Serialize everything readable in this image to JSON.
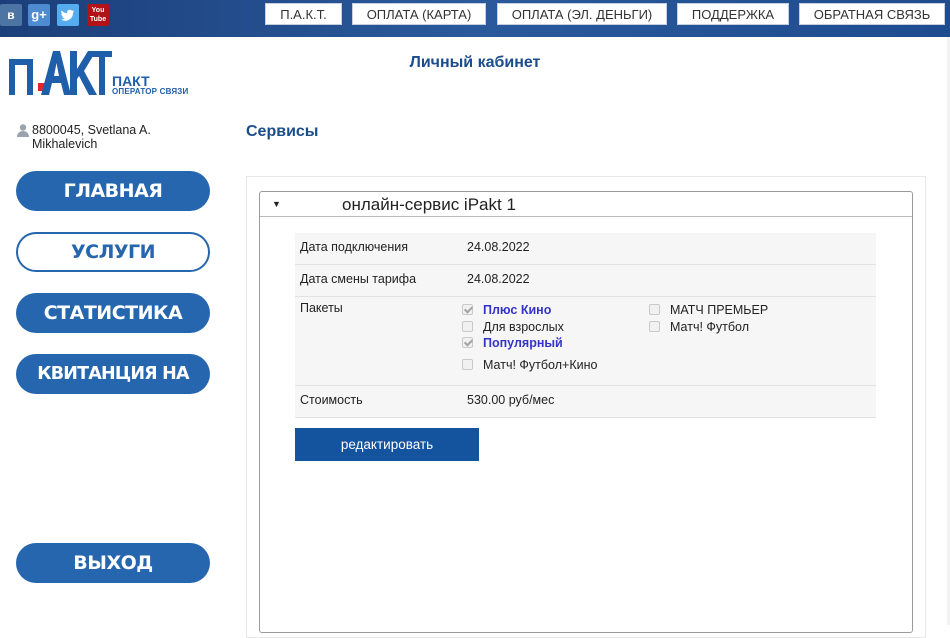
{
  "social": {
    "vk": "в",
    "gplus": "g+",
    "twitter": "🐦",
    "youtube_top": "You",
    "youtube_bottom": "Tube"
  },
  "topnav": [
    {
      "label": "П.А.К.Т."
    },
    {
      "label": "ОПЛАТА (КАРТА)"
    },
    {
      "label": "ОПЛАТА (ЭЛ. ДЕНЬГИ)"
    },
    {
      "label": "ПОДДЕРЖКА"
    },
    {
      "label": "ОБРАТНАЯ СВЯЗЬ"
    }
  ],
  "logo": {
    "name": "ПАКТ",
    "subtitle": "ОПЕРАТОР СВЯЗИ"
  },
  "page_title": "Личный кабинет",
  "user": {
    "line1": "8800045, Svetlana A.",
    "line2": "Mikhalevich"
  },
  "menu": [
    {
      "label": "ГЛАВНАЯ",
      "active": false
    },
    {
      "label": "УСЛУГИ",
      "active": true
    },
    {
      "label": "СТАТИСТИКА",
      "active": false
    },
    {
      "label": "КВИТАНЦИЯ НА ОПЛАТУ",
      "active": false
    },
    {
      "label": "ВЫХОД",
      "active": false
    }
  ],
  "services": {
    "title": "Сервисы",
    "accordion_title": "онлайн-сервис iPakt 1",
    "rows": {
      "connect_date_label": "Дата подключения",
      "connect_date_value": "24.08.2022",
      "tariff_date_label": "Дата смены тарифа",
      "tariff_date_value": "24.08.2022",
      "packages_label": "Пакеты",
      "cost_label": "Стоимость",
      "cost_value": "530.00 руб/мес"
    },
    "packages": [
      {
        "label": "Плюс Кино",
        "checked": true,
        "highlight": true
      },
      {
        "label": "Для взрослых",
        "checked": false,
        "highlight": false
      },
      {
        "label": "Популярный",
        "checked": true,
        "highlight": true
      },
      {
        "label": "Матч! Футбол+Кино",
        "checked": false,
        "highlight": false
      },
      {
        "label": "МАТЧ ПРЕМЬЕР",
        "checked": false,
        "highlight": false
      },
      {
        "label": "Матч! Футбол",
        "checked": false,
        "highlight": false
      }
    ],
    "edit_button": "редактировать"
  },
  "colors": {
    "brand": "#2566ae",
    "header_dark": "#1b3f7a",
    "link_highlight": "#3434c9",
    "edit_button": "#14539e"
  }
}
